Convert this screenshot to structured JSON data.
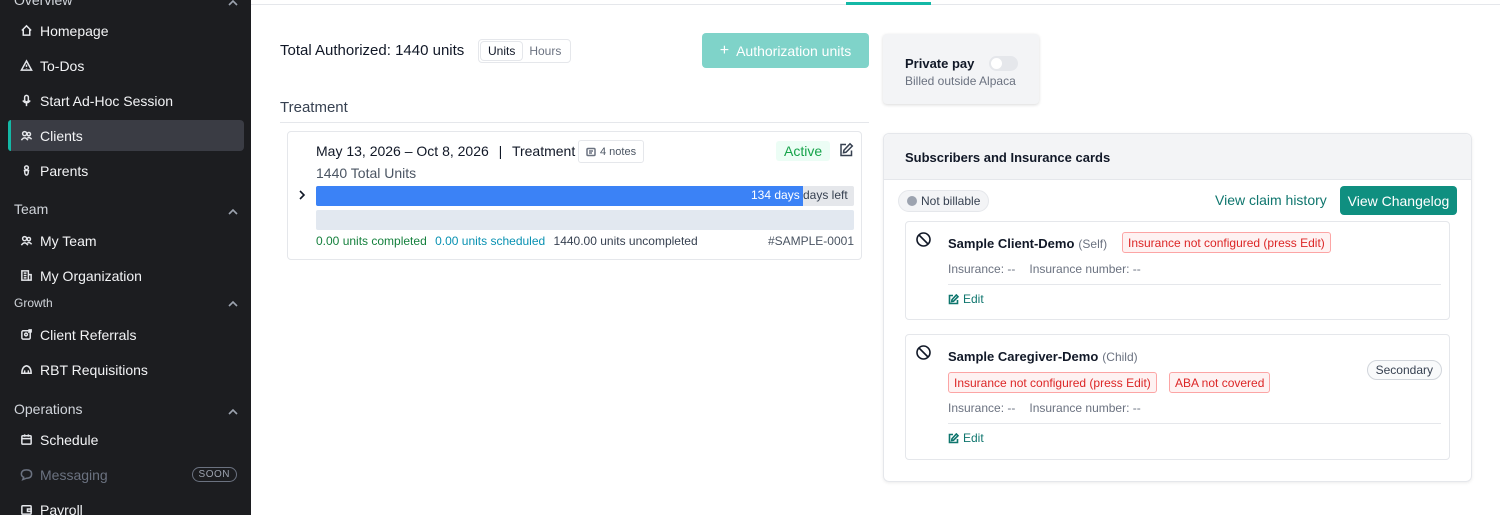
{
  "sidebar": {
    "overview_label": "Overview",
    "items": [
      {
        "label": "Homepage",
        "icon": "home-icon"
      },
      {
        "label": "To-Dos",
        "icon": "alert-triangle-icon"
      },
      {
        "label": "Start Ad-Hoc Session",
        "icon": "microphone-icon"
      },
      {
        "label": "Clients",
        "icon": "users-icon"
      },
      {
        "label": "Parents",
        "icon": "pacifier-icon"
      }
    ],
    "team_label": "Team",
    "team_items": [
      {
        "label": "My Team",
        "icon": "users-icon"
      },
      {
        "label": "My Organization",
        "icon": "building-icon"
      }
    ],
    "growth_label": "Growth",
    "growth_items": [
      {
        "label": "Client Referrals",
        "icon": "referral-icon"
      },
      {
        "label": "RBT Requisitions",
        "icon": "requisition-icon"
      }
    ],
    "operations_label": "Operations",
    "operations_items": [
      {
        "label": "Schedule",
        "icon": "calendar-icon"
      },
      {
        "label": "Messaging",
        "icon": "chat-icon",
        "badge": "SOON"
      },
      {
        "label": "Payroll",
        "icon": "wallet-icon"
      }
    ]
  },
  "authorization": {
    "total_label": "Total Authorized: 1440 units",
    "unit_toggle": [
      "Units",
      "Hours"
    ],
    "add_button": "Authorization units"
  },
  "treatment": {
    "heading": "Treatment",
    "date_range": "May 13, 2026 – Oct 8, 2026",
    "separator": "|",
    "type": "Treatment",
    "notes": "4 notes",
    "status": "Active",
    "total_units": "1440 Total Units",
    "days_value": "134 days",
    "days_left": "days left",
    "progress_fraction": 0.905,
    "completed": "0.00 units completed",
    "scheduled": "0.00 units scheduled",
    "uncompleted": "1440.00 units uncompleted",
    "sample_id": "#SAMPLE-0001"
  },
  "private_pay": {
    "title": "Private pay",
    "subtitle": "Billed outside Alpaca",
    "enabled": false
  },
  "subscribers": {
    "title": "Subscribers and Insurance cards",
    "not_billable": "Not billable",
    "claim_history": "View claim history",
    "changelog": "View Changelog",
    "entries": [
      {
        "name": "Sample Client-Demo",
        "relation": "(Self)",
        "warnings": [
          "Insurance not configured (press Edit)"
        ],
        "insurance": "Insurance: --",
        "insurance_number": "Insurance number: --",
        "edit": "Edit"
      },
      {
        "name": "Sample Caregiver-Demo",
        "relation": "(Child)",
        "warnings": [
          "Insurance not configured (press Edit)",
          "ABA not covered"
        ],
        "insurance": "Insurance: --",
        "insurance_number": "Insurance number: --",
        "edit": "Edit",
        "tag": "Secondary"
      }
    ]
  },
  "colors": {
    "accent": "#14b8a6",
    "primary_button": "#0f8f80",
    "progress": "#3b82f6",
    "warning": "#dc2626"
  }
}
